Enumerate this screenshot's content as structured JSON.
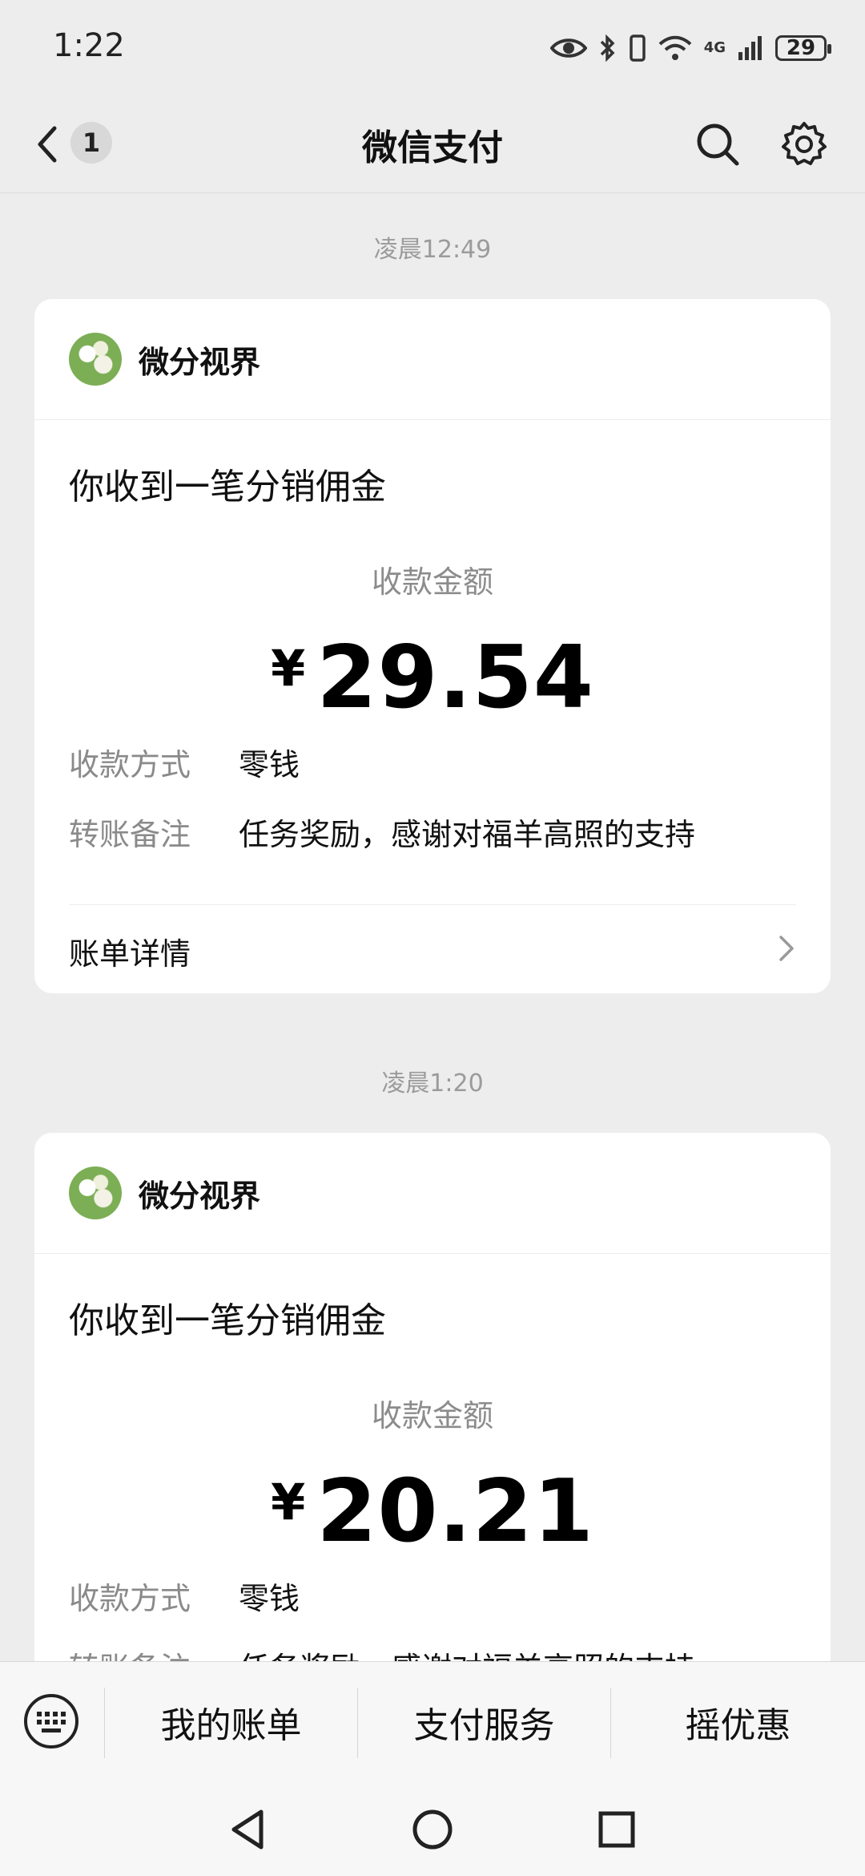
{
  "status_bar": {
    "time": "1:22",
    "battery": "29",
    "network": "4G"
  },
  "header": {
    "unread_count": "1",
    "title": "微信支付"
  },
  "messages": [
    {
      "timestamp": "凌晨12:49",
      "merchant": "微分视界",
      "notice": "你收到一笔分销佣金",
      "amount_label": "收款金额",
      "currency": "¥",
      "amount": "29.54",
      "method_label": "收款方式",
      "method_value": "零钱",
      "remark_label": "转账备注",
      "remark_value": "任务奖励，感谢对福羊高照的支持",
      "detail_label": "账单详情"
    },
    {
      "timestamp": "凌晨1:20",
      "merchant": "微分视界",
      "notice": "你收到一笔分销佣金",
      "amount_label": "收款金额",
      "currency": "¥",
      "amount": "20.21",
      "method_label": "收款方式",
      "method_value": "零钱",
      "remark_label": "转账备注",
      "remark_value": "任务奖励，感谢对福羊高照的支持"
    }
  ],
  "bottom_menu": {
    "items": [
      "我的账单",
      "支付服务",
      "摇优惠"
    ]
  },
  "icons": {
    "back": "chevron-left-icon",
    "search": "search-icon",
    "settings": "gear-icon",
    "keyboard": "keyboard-icon",
    "detail": "chevron-right-icon"
  }
}
